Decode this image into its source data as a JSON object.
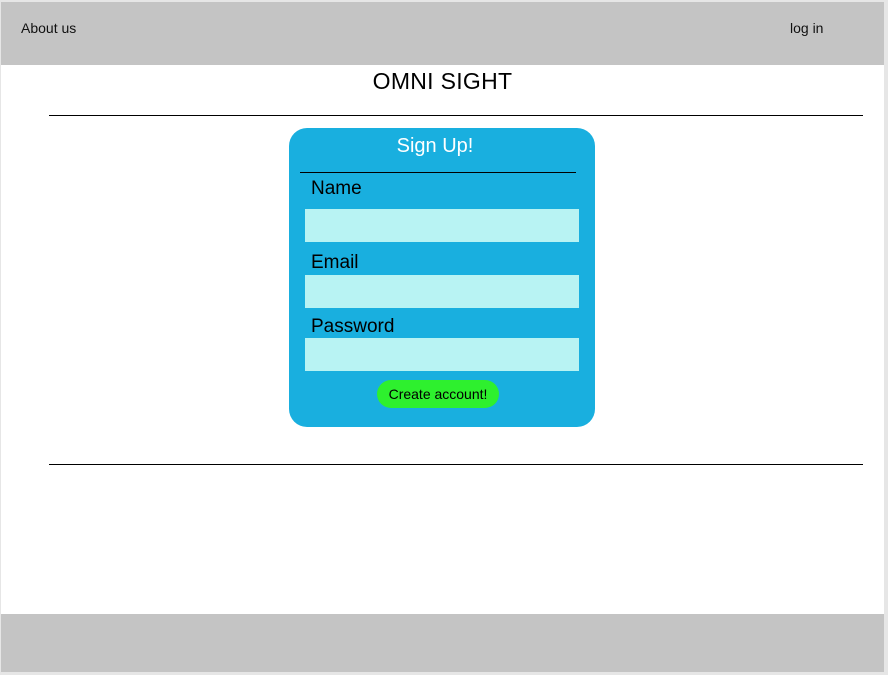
{
  "header": {
    "about_label": "About us",
    "login_label": "log in"
  },
  "page": {
    "title": "OMNI SIGHT"
  },
  "signup": {
    "title": "Sign Up!",
    "fields": [
      {
        "label": "Name",
        "value": ""
      },
      {
        "label": "Email",
        "value": ""
      },
      {
        "label": "Password",
        "value": ""
      }
    ],
    "submit_label": "Create account!"
  },
  "colors": {
    "header_footer": "#c4c4c4",
    "card": "#19afdf",
    "input": "#b8f3f3",
    "submit": "#2ef02e"
  }
}
